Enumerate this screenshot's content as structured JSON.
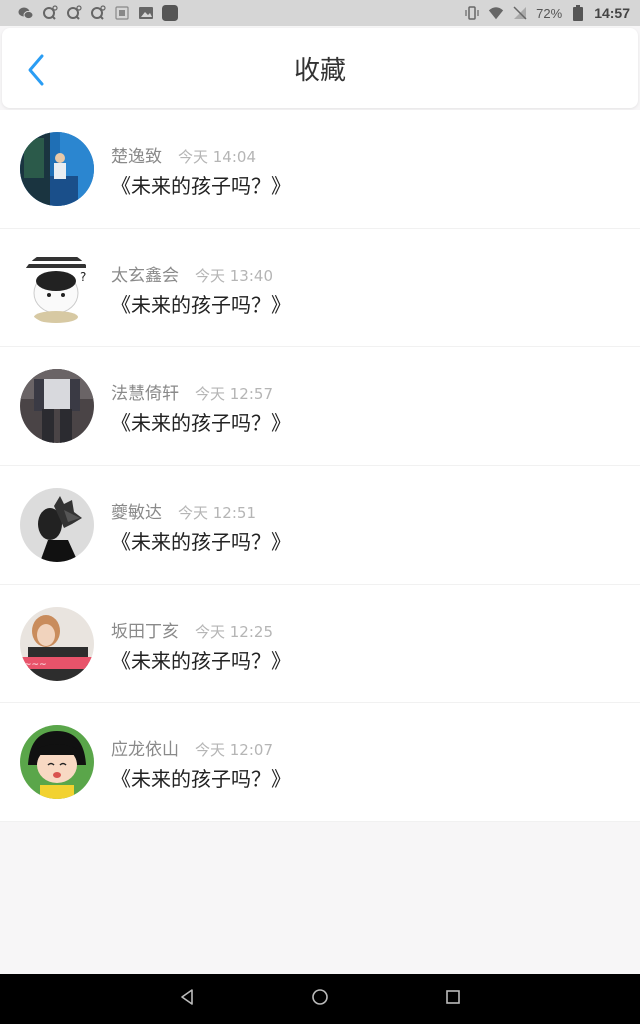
{
  "status_bar": {
    "battery": "72%",
    "time": "14:57",
    "icons_left": [
      "wechat-icon",
      "search-q-icon",
      "search-q-icon",
      "search-q-icon",
      "sim-icon",
      "image-icon",
      "app-icon"
    ],
    "icons_right": [
      "vibrate-icon",
      "wifi-icon",
      "no-sim-icon",
      "battery-icon"
    ]
  },
  "header": {
    "title": "收藏",
    "back_icon": "chevron-left-icon",
    "accent_color": "#2a9df4"
  },
  "items": [
    {
      "name": "楚逸致",
      "time": "今天 14:04",
      "title": "《未来的孩子吗？》"
    },
    {
      "name": "太玄鑫会",
      "time": "今天 13:40",
      "title": "《未来的孩子吗？》"
    },
    {
      "name": "法慧倚轩",
      "time": "今天 12:57",
      "title": "《未来的孩子吗？》"
    },
    {
      "name": "夔敏达",
      "time": "今天 12:51",
      "title": "《未来的孩子吗？》"
    },
    {
      "name": "坂田丁亥",
      "time": "今天 12:25",
      "title": "《未来的孩子吗？》"
    },
    {
      "name": "应龙依山",
      "time": "今天 12:07",
      "title": "《未来的孩子吗？》"
    }
  ],
  "nav_bar": {
    "icons": [
      "back-triangle-icon",
      "home-circle-icon",
      "recents-square-icon"
    ]
  }
}
